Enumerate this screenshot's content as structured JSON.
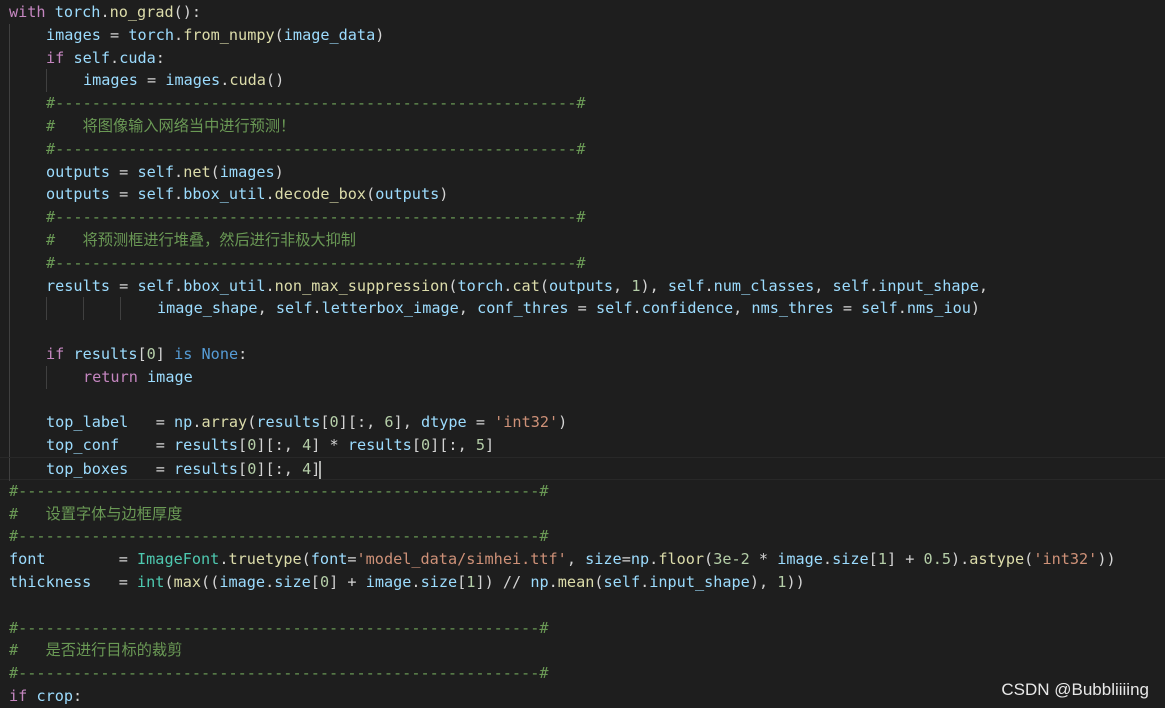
{
  "watermark": "CSDN @Bubbliiiing",
  "lines": [
    {
      "indent": 0,
      "tokens": [
        [
          "kw",
          "with"
        ],
        [
          "op",
          " "
        ],
        [
          "var",
          "torch"
        ],
        [
          "op",
          "."
        ],
        [
          "fn",
          "no_grad"
        ],
        [
          "op",
          "():"
        ]
      ]
    },
    {
      "indent": 1,
      "tokens": [
        [
          "var",
          "images"
        ],
        [
          "op",
          " = "
        ],
        [
          "var",
          "torch"
        ],
        [
          "op",
          "."
        ],
        [
          "fn",
          "from_numpy"
        ],
        [
          "op",
          "("
        ],
        [
          "var",
          "image_data"
        ],
        [
          "op",
          ")"
        ]
      ]
    },
    {
      "indent": 1,
      "tokens": [
        [
          "kw",
          "if"
        ],
        [
          "op",
          " "
        ],
        [
          "var",
          "self"
        ],
        [
          "op",
          "."
        ],
        [
          "var",
          "cuda"
        ],
        [
          "op",
          ":"
        ]
      ]
    },
    {
      "indent": 2,
      "tokens": [
        [
          "var",
          "images"
        ],
        [
          "op",
          " = "
        ],
        [
          "var",
          "images"
        ],
        [
          "op",
          "."
        ],
        [
          "fn",
          "cuda"
        ],
        [
          "op",
          "()"
        ]
      ]
    },
    {
      "indent": 1,
      "tokens": [
        [
          "cm",
          "#---------------------------------------------------------#"
        ]
      ]
    },
    {
      "indent": 1,
      "tokens": [
        [
          "cm",
          "#   将图像输入网络当中进行预测！"
        ]
      ]
    },
    {
      "indent": 1,
      "tokens": [
        [
          "cm",
          "#---------------------------------------------------------#"
        ]
      ]
    },
    {
      "indent": 1,
      "tokens": [
        [
          "var",
          "outputs"
        ],
        [
          "op",
          " = "
        ],
        [
          "var",
          "self"
        ],
        [
          "op",
          "."
        ],
        [
          "fn",
          "net"
        ],
        [
          "op",
          "("
        ],
        [
          "var",
          "images"
        ],
        [
          "op",
          ")"
        ]
      ]
    },
    {
      "indent": 1,
      "tokens": [
        [
          "var",
          "outputs"
        ],
        [
          "op",
          " = "
        ],
        [
          "var",
          "self"
        ],
        [
          "op",
          "."
        ],
        [
          "var",
          "bbox_util"
        ],
        [
          "op",
          "."
        ],
        [
          "fn",
          "decode_box"
        ],
        [
          "op",
          "("
        ],
        [
          "var",
          "outputs"
        ],
        [
          "op",
          ")"
        ]
      ]
    },
    {
      "indent": 1,
      "tokens": [
        [
          "cm",
          "#---------------------------------------------------------#"
        ]
      ]
    },
    {
      "indent": 1,
      "tokens": [
        [
          "cm",
          "#   将预测框进行堆叠，然后进行非极大抑制"
        ]
      ]
    },
    {
      "indent": 1,
      "tokens": [
        [
          "cm",
          "#---------------------------------------------------------#"
        ]
      ]
    },
    {
      "indent": 1,
      "tokens": [
        [
          "var",
          "results"
        ],
        [
          "op",
          " = "
        ],
        [
          "var",
          "self"
        ],
        [
          "op",
          "."
        ],
        [
          "var",
          "bbox_util"
        ],
        [
          "op",
          "."
        ],
        [
          "fn",
          "non_max_suppression"
        ],
        [
          "op",
          "("
        ],
        [
          "var",
          "torch"
        ],
        [
          "op",
          "."
        ],
        [
          "fn",
          "cat"
        ],
        [
          "op",
          "("
        ],
        [
          "var",
          "outputs"
        ],
        [
          "op",
          ", "
        ],
        [
          "num",
          "1"
        ],
        [
          "op",
          "), "
        ],
        [
          "var",
          "self"
        ],
        [
          "op",
          "."
        ],
        [
          "var",
          "num_classes"
        ],
        [
          "op",
          ", "
        ],
        [
          "var",
          "self"
        ],
        [
          "op",
          "."
        ],
        [
          "var",
          "input_shape"
        ],
        [
          "op",
          ","
        ]
      ]
    },
    {
      "indent": 4,
      "pad": 12,
      "tokens": [
        [
          "var",
          "image_shape"
        ],
        [
          "op",
          ", "
        ],
        [
          "var",
          "self"
        ],
        [
          "op",
          "."
        ],
        [
          "var",
          "letterbox_image"
        ],
        [
          "op",
          ", "
        ],
        [
          "var",
          "conf_thres"
        ],
        [
          "op",
          " = "
        ],
        [
          "var",
          "self"
        ],
        [
          "op",
          "."
        ],
        [
          "var",
          "confidence"
        ],
        [
          "op",
          ", "
        ],
        [
          "var",
          "nms_thres"
        ],
        [
          "op",
          " = "
        ],
        [
          "var",
          "self"
        ],
        [
          "op",
          "."
        ],
        [
          "var",
          "nms_iou"
        ],
        [
          "op",
          ")"
        ]
      ]
    },
    {
      "indent": 1,
      "tokens": []
    },
    {
      "indent": 1,
      "tokens": [
        [
          "kw",
          "if"
        ],
        [
          "op",
          " "
        ],
        [
          "var",
          "results"
        ],
        [
          "op",
          "["
        ],
        [
          "num",
          "0"
        ],
        [
          "op",
          "] "
        ],
        [
          "bl",
          "is"
        ],
        [
          "op",
          " "
        ],
        [
          "bl",
          "None"
        ],
        [
          "op",
          ":"
        ]
      ]
    },
    {
      "indent": 2,
      "tokens": [
        [
          "kw",
          "return"
        ],
        [
          "op",
          " "
        ],
        [
          "var",
          "image"
        ]
      ]
    },
    {
      "indent": 1,
      "tokens": []
    },
    {
      "indent": 1,
      "tokens": [
        [
          "var",
          "top_label"
        ],
        [
          "op",
          "   = "
        ],
        [
          "var",
          "np"
        ],
        [
          "op",
          "."
        ],
        [
          "fn",
          "array"
        ],
        [
          "op",
          "("
        ],
        [
          "var",
          "results"
        ],
        [
          "op",
          "["
        ],
        [
          "num",
          "0"
        ],
        [
          "op",
          "][:, "
        ],
        [
          "num",
          "6"
        ],
        [
          "op",
          "], "
        ],
        [
          "var",
          "dtype"
        ],
        [
          "op",
          " = "
        ],
        [
          "str",
          "'int32'"
        ],
        [
          "op",
          ")"
        ]
      ]
    },
    {
      "indent": 1,
      "tokens": [
        [
          "var",
          "top_conf"
        ],
        [
          "op",
          "    = "
        ],
        [
          "var",
          "results"
        ],
        [
          "op",
          "["
        ],
        [
          "num",
          "0"
        ],
        [
          "op",
          "][:, "
        ],
        [
          "num",
          "4"
        ],
        [
          "op",
          "] * "
        ],
        [
          "var",
          "results"
        ],
        [
          "op",
          "["
        ],
        [
          "num",
          "0"
        ],
        [
          "op",
          "][:, "
        ],
        [
          "num",
          "5"
        ],
        [
          "op",
          "]"
        ]
      ]
    },
    {
      "indent": 1,
      "current": true,
      "tokens": [
        [
          "var",
          "top_boxes"
        ],
        [
          "op",
          "   = "
        ],
        [
          "var",
          "results"
        ],
        [
          "op",
          "["
        ],
        [
          "num",
          "0"
        ],
        [
          "op",
          "]"
        ],
        [
          "op",
          "[:, "
        ],
        [
          "num",
          "4"
        ],
        [
          "op",
          "]"
        ]
      ]
    },
    {
      "indent": 0,
      "tokens": [
        [
          "cm",
          "#---------------------------------------------------------#"
        ]
      ]
    },
    {
      "indent": 0,
      "tokens": [
        [
          "cm",
          "#   设置字体与边框厚度"
        ]
      ]
    },
    {
      "indent": 0,
      "tokens": [
        [
          "cm",
          "#---------------------------------------------------------#"
        ]
      ]
    },
    {
      "indent": 0,
      "tokens": [
        [
          "var",
          "font"
        ],
        [
          "op",
          "        = "
        ],
        [
          "cls",
          "ImageFont"
        ],
        [
          "op",
          "."
        ],
        [
          "fn",
          "truetype"
        ],
        [
          "op",
          "("
        ],
        [
          "var",
          "font"
        ],
        [
          "op",
          "="
        ],
        [
          "str",
          "'model_data/simhei.ttf'"
        ],
        [
          "op",
          ", "
        ],
        [
          "var",
          "size"
        ],
        [
          "op",
          "="
        ],
        [
          "var",
          "np"
        ],
        [
          "op",
          "."
        ],
        [
          "fn",
          "floor"
        ],
        [
          "op",
          "("
        ],
        [
          "num",
          "3e-2"
        ],
        [
          "op",
          " * "
        ],
        [
          "var",
          "image"
        ],
        [
          "op",
          "."
        ],
        [
          "var",
          "size"
        ],
        [
          "op",
          "["
        ],
        [
          "num",
          "1"
        ],
        [
          "op",
          "] + "
        ],
        [
          "num",
          "0.5"
        ],
        [
          "op",
          ")."
        ],
        [
          "fn",
          "astype"
        ],
        [
          "op",
          "("
        ],
        [
          "str",
          "'int32'"
        ],
        [
          "op",
          "))"
        ]
      ]
    },
    {
      "indent": 0,
      "tokens": [
        [
          "var",
          "thickness"
        ],
        [
          "op",
          "   = "
        ],
        [
          "cls",
          "int"
        ],
        [
          "op",
          "("
        ],
        [
          "fn",
          "max"
        ],
        [
          "op",
          "(("
        ],
        [
          "var",
          "image"
        ],
        [
          "op",
          "."
        ],
        [
          "var",
          "size"
        ],
        [
          "op",
          "["
        ],
        [
          "num",
          "0"
        ],
        [
          "op",
          "] + "
        ],
        [
          "var",
          "image"
        ],
        [
          "op",
          "."
        ],
        [
          "var",
          "size"
        ],
        [
          "op",
          "["
        ],
        [
          "num",
          "1"
        ],
        [
          "op",
          "]) // "
        ],
        [
          "var",
          "np"
        ],
        [
          "op",
          "."
        ],
        [
          "fn",
          "mean"
        ],
        [
          "op",
          "("
        ],
        [
          "var",
          "self"
        ],
        [
          "op",
          "."
        ],
        [
          "var",
          "input_shape"
        ],
        [
          "op",
          "), "
        ],
        [
          "num",
          "1"
        ],
        [
          "op",
          "))"
        ]
      ]
    },
    {
      "indent": 0,
      "tokens": []
    },
    {
      "indent": 0,
      "tokens": [
        [
          "cm",
          "#---------------------------------------------------------#"
        ]
      ]
    },
    {
      "indent": 0,
      "tokens": [
        [
          "cm",
          "#   是否进行目标的裁剪"
        ]
      ]
    },
    {
      "indent": 0,
      "tokens": [
        [
          "cm",
          "#---------------------------------------------------------#"
        ]
      ]
    },
    {
      "indent": 0,
      "tokens": [
        [
          "kw",
          "if"
        ],
        [
          "op",
          " "
        ],
        [
          "var",
          "crop"
        ],
        [
          "op",
          ":"
        ]
      ]
    }
  ]
}
